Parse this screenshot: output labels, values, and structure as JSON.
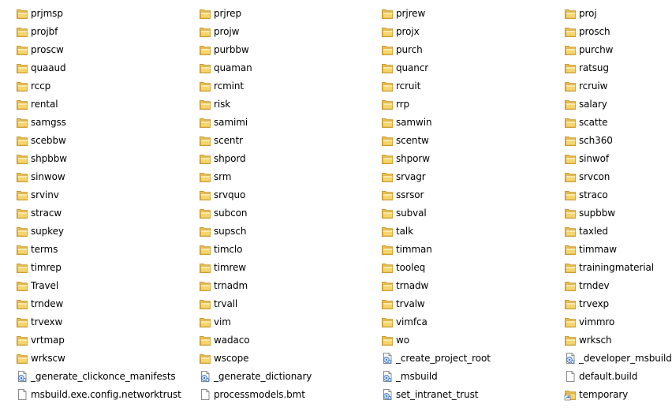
{
  "explorer": {
    "columns": [
      [
        {
          "name": "prjmsp",
          "icon": "folder-icon"
        },
        {
          "name": "projbf",
          "icon": "folder-icon"
        },
        {
          "name": "proscw",
          "icon": "folder-icon"
        },
        {
          "name": "quaaud",
          "icon": "folder-icon"
        },
        {
          "name": "rccp",
          "icon": "folder-icon"
        },
        {
          "name": "rental",
          "icon": "folder-icon"
        },
        {
          "name": "samgss",
          "icon": "folder-icon"
        },
        {
          "name": "scebbw",
          "icon": "folder-icon"
        },
        {
          "name": "shpbbw",
          "icon": "folder-icon"
        },
        {
          "name": "sinwow",
          "icon": "folder-icon"
        },
        {
          "name": "srvinv",
          "icon": "folder-icon"
        },
        {
          "name": "stracw",
          "icon": "folder-icon"
        },
        {
          "name": "supkey",
          "icon": "folder-icon"
        },
        {
          "name": "terms",
          "icon": "folder-icon"
        },
        {
          "name": "timrep",
          "icon": "folder-icon"
        },
        {
          "name": "Travel",
          "icon": "folder-icon"
        },
        {
          "name": "trndew",
          "icon": "folder-icon"
        },
        {
          "name": "trvexw",
          "icon": "folder-icon"
        },
        {
          "name": "vrtmap",
          "icon": "folder-icon"
        },
        {
          "name": "wrkscw",
          "icon": "folder-icon"
        },
        {
          "name": "_generate_clickonce_manifests",
          "icon": "script-file-icon"
        },
        {
          "name": "msbuild.exe.config.networktrust",
          "icon": "file-icon"
        }
      ],
      [
        {
          "name": "prjrep",
          "icon": "folder-icon"
        },
        {
          "name": "projw",
          "icon": "folder-icon"
        },
        {
          "name": "purbbw",
          "icon": "folder-icon"
        },
        {
          "name": "quaman",
          "icon": "folder-icon"
        },
        {
          "name": "rcmint",
          "icon": "folder-icon"
        },
        {
          "name": "risk",
          "icon": "folder-icon"
        },
        {
          "name": "samimi",
          "icon": "folder-icon"
        },
        {
          "name": "scentr",
          "icon": "folder-icon"
        },
        {
          "name": "shpord",
          "icon": "folder-icon"
        },
        {
          "name": "srm",
          "icon": "folder-icon"
        },
        {
          "name": "srvquo",
          "icon": "folder-icon"
        },
        {
          "name": "subcon",
          "icon": "folder-icon"
        },
        {
          "name": "supsch",
          "icon": "folder-icon"
        },
        {
          "name": "timclo",
          "icon": "folder-icon"
        },
        {
          "name": "timrew",
          "icon": "folder-icon"
        },
        {
          "name": "trnadm",
          "icon": "folder-icon"
        },
        {
          "name": "trvall",
          "icon": "folder-icon"
        },
        {
          "name": "vim",
          "icon": "folder-icon"
        },
        {
          "name": "wadaco",
          "icon": "folder-icon"
        },
        {
          "name": "wscope",
          "icon": "folder-icon"
        },
        {
          "name": "_generate_dictionary",
          "icon": "script-file-icon"
        },
        {
          "name": "processmodels.bmt",
          "icon": "file-icon"
        }
      ],
      [
        {
          "name": "prjrew",
          "icon": "folder-icon"
        },
        {
          "name": "projx",
          "icon": "folder-icon"
        },
        {
          "name": "purch",
          "icon": "folder-icon"
        },
        {
          "name": "quancr",
          "icon": "folder-icon"
        },
        {
          "name": "rcruit",
          "icon": "folder-icon"
        },
        {
          "name": "rrp",
          "icon": "folder-icon"
        },
        {
          "name": "samwin",
          "icon": "folder-icon"
        },
        {
          "name": "scentw",
          "icon": "folder-icon"
        },
        {
          "name": "shporw",
          "icon": "folder-icon"
        },
        {
          "name": "srvagr",
          "icon": "folder-icon"
        },
        {
          "name": "ssrsor",
          "icon": "folder-icon"
        },
        {
          "name": "subval",
          "icon": "folder-icon"
        },
        {
          "name": "talk",
          "icon": "folder-icon"
        },
        {
          "name": "timman",
          "icon": "folder-icon"
        },
        {
          "name": "tooleq",
          "icon": "folder-icon"
        },
        {
          "name": "trnadw",
          "icon": "folder-icon"
        },
        {
          "name": "trvalw",
          "icon": "folder-icon"
        },
        {
          "name": "vimfca",
          "icon": "folder-icon"
        },
        {
          "name": "wo",
          "icon": "folder-icon"
        },
        {
          "name": "_create_project_root",
          "icon": "script-file-icon"
        },
        {
          "name": "_msbuild",
          "icon": "script-file-icon"
        },
        {
          "name": "set_intranet_trust",
          "icon": "script-file-icon"
        }
      ],
      [
        {
          "name": "proj",
          "icon": "folder-icon"
        },
        {
          "name": "prosch",
          "icon": "folder-icon"
        },
        {
          "name": "purchw",
          "icon": "folder-icon"
        },
        {
          "name": "ratsug",
          "icon": "folder-icon"
        },
        {
          "name": "rcruiw",
          "icon": "folder-icon"
        },
        {
          "name": "salary",
          "icon": "folder-icon"
        },
        {
          "name": "scatte",
          "icon": "folder-icon"
        },
        {
          "name": "sch360",
          "icon": "folder-icon"
        },
        {
          "name": "sinwof",
          "icon": "folder-icon"
        },
        {
          "name": "srvcon",
          "icon": "folder-icon"
        },
        {
          "name": "straco",
          "icon": "folder-icon"
        },
        {
          "name": "supbbw",
          "icon": "folder-icon"
        },
        {
          "name": "taxled",
          "icon": "folder-icon"
        },
        {
          "name": "timmaw",
          "icon": "folder-icon"
        },
        {
          "name": "trainingmaterial",
          "icon": "folder-icon"
        },
        {
          "name": "trndev",
          "icon": "folder-icon"
        },
        {
          "name": "trvexp",
          "icon": "folder-icon"
        },
        {
          "name": "vimmro",
          "icon": "folder-icon"
        },
        {
          "name": "wrksch",
          "icon": "folder-icon"
        },
        {
          "name": "_developer_msbuild",
          "icon": "script-file-icon"
        },
        {
          "name": "default.build",
          "icon": "file-icon"
        },
        {
          "name": "temporary",
          "icon": "folder-shortcut-icon"
        }
      ]
    ]
  },
  "colors": {
    "folder_body": "#f6d56d",
    "folder_front": "#fbe28f",
    "folder_edge": "#d4a53c",
    "script_blue": "#3b78c9",
    "file_edge": "#9a9a9a"
  }
}
